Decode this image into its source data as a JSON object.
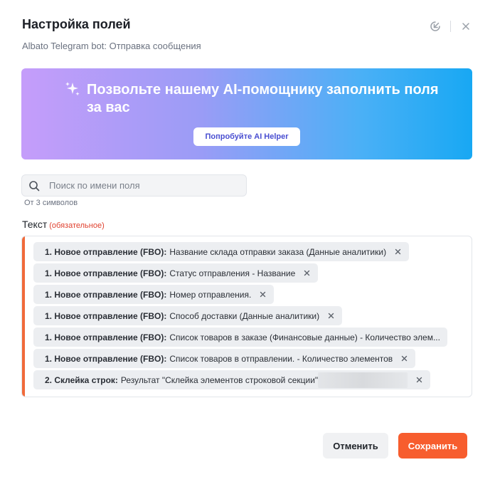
{
  "header": {
    "title": "Настройка полей",
    "subtitle": "Albato Telegram bot: Отправка сообщения"
  },
  "ai_banner": {
    "title": "Позвольте нашему AI-помощнику заполнить поля за вас",
    "button_label": "Попробуйте AI Helper"
  },
  "search": {
    "placeholder": "Поиск по имени поля",
    "hint": "От 3 символов"
  },
  "field": {
    "label": "Текст",
    "required_label": "(обязательное)",
    "chips": [
      {
        "prefix": "1. Новое отправление (FBO):",
        "text": "Название склада отправки заказа (Данные аналитики)"
      },
      {
        "prefix": "1. Новое отправление (FBO):",
        "text": "Статус отправления - Название"
      },
      {
        "prefix": "1. Новое отправление (FBO):",
        "text": "Номер отправления."
      },
      {
        "prefix": "1. Новое отправление (FBO):",
        "text": "Способ доставки (Данные аналитики)"
      },
      {
        "prefix": "1. Новое отправление (FBO):",
        "text": "Список товаров в заказе (Финансовые данные) - Количество элем..."
      },
      {
        "prefix": "1. Новое отправление (FBO):",
        "text": "Список товаров в отправлении. - Количество элементов"
      },
      {
        "prefix": "2. Склейка строк:",
        "text": "Результат \"Склейка элементов строковой секции\""
      }
    ]
  },
  "footer": {
    "cancel_label": "Отменить",
    "save_label": "Сохранить"
  },
  "colors": {
    "accent": "#f75d2e",
    "required": "#e0412f",
    "ai_button_text": "#4a4fd1"
  },
  "icons": {
    "collapse": "collapse-icon",
    "close": "close-icon",
    "sparkle": "sparkle-icon",
    "search": "search-icon",
    "chip_remove": "close-icon"
  }
}
